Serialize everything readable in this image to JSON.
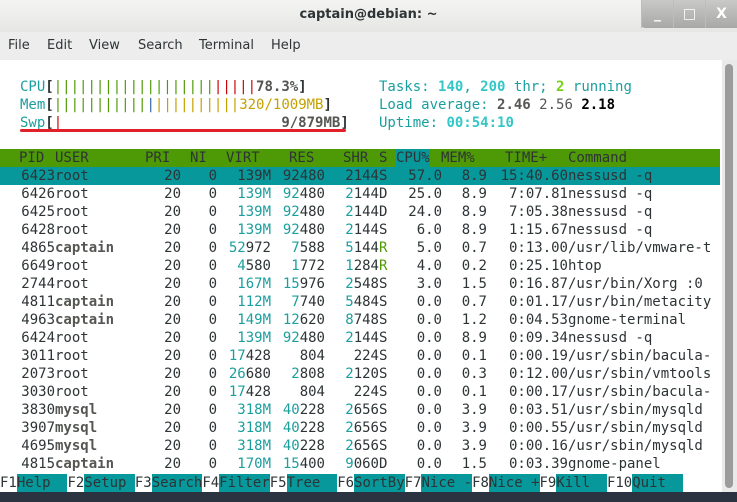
{
  "window": {
    "title": "captain@debian: ~",
    "buttons": {
      "minimize": "_",
      "maximize": "□",
      "close": "X"
    }
  },
  "menu": [
    "File",
    "Edit",
    "View",
    "Search",
    "Terminal",
    "Help"
  ],
  "meters": {
    "cpu": {
      "label": "CPU",
      "value": "78.3%",
      "percent": 78.3,
      "green_bars": 19,
      "red_bars": 5
    },
    "mem": {
      "label": "Mem",
      "value": "320/1009MB",
      "green_bars": 11,
      "blue_bars": 1,
      "yellow_bars": 10
    },
    "swp": {
      "label": "Swp",
      "value": "9/879MB",
      "red_bars": 1
    }
  },
  "summary": {
    "tasks_label": "Tasks: ",
    "tasks": "140",
    "sep": ", ",
    "threads": "200",
    "thr_label": " thr; ",
    "running": "2",
    "running_label": " running",
    "load_label": "Load average: ",
    "load1": "2.46",
    "load5": "2.56",
    "load15": "2.18",
    "uptime_label": "Uptime: ",
    "uptime": "00:54:10"
  },
  "table": {
    "headers": {
      "pid": "PID",
      "user": "USER",
      "pri": "PRI",
      "ni": "NI",
      "virt": "VIRT",
      "res": "RES",
      "shr": "SHR",
      "s": "S",
      "cpu": "CPU%",
      "mem": "MEM%",
      "time": "TIME+",
      "command": "Command"
    },
    "sorted_by": "CPU%",
    "selected_row": 0,
    "rows": [
      {
        "pid": "6423",
        "user": "root",
        "pri": "20",
        "ni": "0",
        "virt": "139M",
        "res": "92480",
        "shr": "2144",
        "s": "S",
        "cpu": "57.0",
        "mem": "8.9",
        "time": "15:40.60",
        "command": "nessusd -q"
      },
      {
        "pid": "6426",
        "user": "root",
        "pri": "20",
        "ni": "0",
        "virt": "139M",
        "res": "92480",
        "shr": "2144",
        "s": "D",
        "cpu": "25.0",
        "mem": "8.9",
        "time": "7:07.81",
        "command": "nessusd -q"
      },
      {
        "pid": "6425",
        "user": "root",
        "pri": "20",
        "ni": "0",
        "virt": "139M",
        "res": "92480",
        "shr": "2144",
        "s": "D",
        "cpu": "24.0",
        "mem": "8.9",
        "time": "7:05.38",
        "command": "nessusd -q"
      },
      {
        "pid": "6428",
        "user": "root",
        "pri": "20",
        "ni": "0",
        "virt": "139M",
        "res": "92480",
        "shr": "2144",
        "s": "S",
        "cpu": "6.0",
        "mem": "8.9",
        "time": "1:15.67",
        "command": "nessusd -q"
      },
      {
        "pid": "4865",
        "user": "captain",
        "pri": "20",
        "ni": "0",
        "virt": "52972",
        "res": "7588",
        "shr": "5144",
        "s": "R",
        "cpu": "5.0",
        "mem": "0.7",
        "time": "0:13.00",
        "command": "/usr/lib/vmware-t"
      },
      {
        "pid": "6649",
        "user": "root",
        "pri": "20",
        "ni": "0",
        "virt": "4580",
        "res": "1772",
        "shr": "1284",
        "s": "R",
        "cpu": "4.0",
        "mem": "0.2",
        "time": "0:25.10",
        "command": "htop"
      },
      {
        "pid": "2744",
        "user": "root",
        "pri": "20",
        "ni": "0",
        "virt": "167M",
        "res": "15976",
        "shr": "2548",
        "s": "S",
        "cpu": "3.0",
        "mem": "1.5",
        "time": "0:16.87",
        "command": "/usr/bin/Xorg :0"
      },
      {
        "pid": "4811",
        "user": "captain",
        "pri": "20",
        "ni": "0",
        "virt": "112M",
        "res": "7740",
        "shr": "5484",
        "s": "S",
        "cpu": "0.0",
        "mem": "0.7",
        "time": "0:01.17",
        "command": "/usr/bin/metacity"
      },
      {
        "pid": "4963",
        "user": "captain",
        "pri": "20",
        "ni": "0",
        "virt": "149M",
        "res": "12620",
        "shr": "8748",
        "s": "S",
        "cpu": "0.0",
        "mem": "1.2",
        "time": "0:04.53",
        "command": "gnome-terminal"
      },
      {
        "pid": "6424",
        "user": "root",
        "pri": "20",
        "ni": "0",
        "virt": "139M",
        "res": "92480",
        "shr": "2144",
        "s": "S",
        "cpu": "0.0",
        "mem": "8.9",
        "time": "0:09.34",
        "command": "nessusd -q"
      },
      {
        "pid": "3011",
        "user": "root",
        "pri": "20",
        "ni": "0",
        "virt": "17428",
        "res": "804",
        "shr": "224",
        "s": "S",
        "cpu": "0.0",
        "mem": "0.1",
        "time": "0:00.19",
        "command": "/usr/sbin/bacula-"
      },
      {
        "pid": "2073",
        "user": "root",
        "pri": "20",
        "ni": "0",
        "virt": "26680",
        "res": "2808",
        "shr": "2120",
        "s": "S",
        "cpu": "0.0",
        "mem": "0.3",
        "time": "0:12.00",
        "command": "/usr/sbin/vmtools"
      },
      {
        "pid": "3030",
        "user": "root",
        "pri": "20",
        "ni": "0",
        "virt": "17428",
        "res": "804",
        "shr": "224",
        "s": "S",
        "cpu": "0.0",
        "mem": "0.1",
        "time": "0:00.17",
        "command": "/usr/sbin/bacula-"
      },
      {
        "pid": "3830",
        "user": "mysql",
        "pri": "20",
        "ni": "0",
        "virt": "318M",
        "res": "40228",
        "shr": "2656",
        "s": "S",
        "cpu": "0.0",
        "mem": "3.9",
        "time": "0:03.51",
        "command": "/usr/sbin/mysqld"
      },
      {
        "pid": "3907",
        "user": "mysql",
        "pri": "20",
        "ni": "0",
        "virt": "318M",
        "res": "40228",
        "shr": "2656",
        "s": "S",
        "cpu": "0.0",
        "mem": "3.9",
        "time": "0:00.55",
        "command": "/usr/sbin/mysqld"
      },
      {
        "pid": "4695",
        "user": "mysql",
        "pri": "20",
        "ni": "0",
        "virt": "318M",
        "res": "40228",
        "shr": "2656",
        "s": "S",
        "cpu": "0.0",
        "mem": "3.9",
        "time": "0:00.16",
        "command": "/usr/sbin/mysqld"
      },
      {
        "pid": "4815",
        "user": "captain",
        "pri": "20",
        "ni": "0",
        "virt": "170M",
        "res": "15400",
        "shr": "9060",
        "s": "D",
        "cpu": "0.0",
        "mem": "1.5",
        "time": "0:03.39",
        "command": "gnome-panel"
      }
    ]
  },
  "fkeys": [
    {
      "key": "F1",
      "label": "Help  "
    },
    {
      "key": "F2",
      "label": "Setup "
    },
    {
      "key": "F3",
      "label": "Search"
    },
    {
      "key": "F4",
      "label": "Filter"
    },
    {
      "key": "F5",
      "label": "Tree  "
    },
    {
      "key": "F6",
      "label": "SortBy"
    },
    {
      "key": "F7",
      "label": "Nice -"
    },
    {
      "key": "F8",
      "label": "Nice +"
    },
    {
      "key": "F9",
      "label": "Kill  "
    },
    {
      "key": "F10",
      "label": "Quit  "
    }
  ],
  "annotation": {
    "color": "#e2202a"
  }
}
